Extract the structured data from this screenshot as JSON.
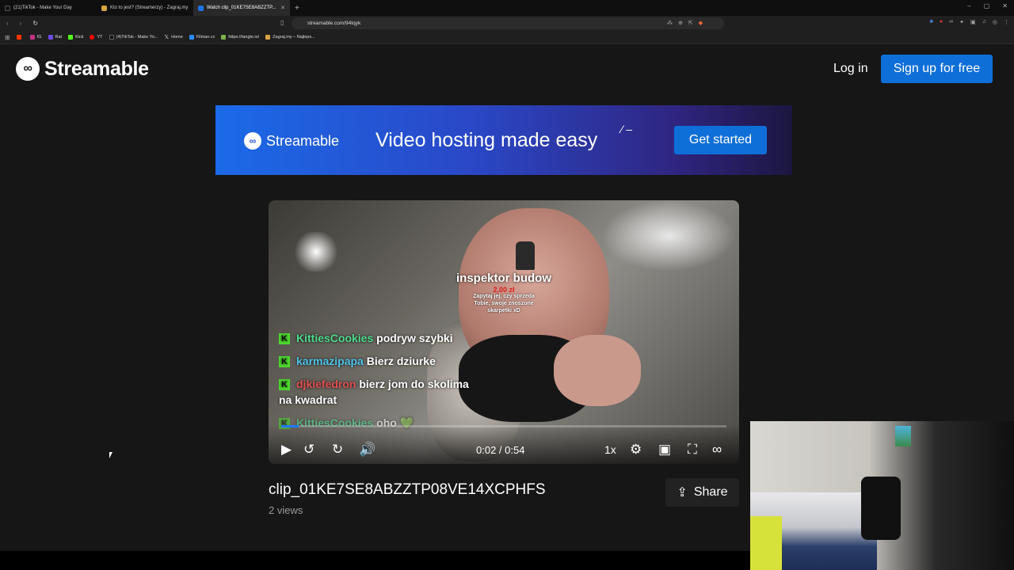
{
  "browser": {
    "tabs": [
      {
        "label": "(21)TikTok - Make Your Day",
        "color": "#111111"
      },
      {
        "label": "Kto to jest? (Streamerzy) - Zagraj.my",
        "color": "#d9a441"
      },
      {
        "label": "Watch clip_01KE7SE8ABZZTP...",
        "color": "#1a73e8",
        "active": true
      }
    ],
    "new_tab": "+",
    "window_controls": [
      "–",
      "▢",
      "✕"
    ],
    "url": "streamable.com/94tqyk",
    "bookmarks": [
      {
        "label": "",
        "color": "#ff3300"
      },
      {
        "label": "IG",
        "color": "#c13584"
      },
      {
        "label": "Rat",
        "color": "#6b4ce6"
      },
      {
        "label": "Kick",
        "color": "#53fc18"
      },
      {
        "label": "YT",
        "color": "#ff0000"
      },
      {
        "label": "(4)TikTok - Make Yo...",
        "color": "#111111"
      },
      {
        "label": "Home",
        "color": "#ffffff"
      },
      {
        "label": "Filman.cc",
        "color": "#2b8cff"
      },
      {
        "label": "https://tangle.io/",
        "color": "#7bb34a"
      },
      {
        "label": "Zagraj.my – Najleps...",
        "color": "#d9a441"
      }
    ]
  },
  "header": {
    "logo_text": "Streamable",
    "login": "Log in",
    "signup": "Sign up for free"
  },
  "banner": {
    "logo_text": "Streamable",
    "headline": "Video hosting made easy",
    "cta": "Get started"
  },
  "video": {
    "overlay_title": "inspektor budow",
    "overlay_price": "2,00 zł",
    "overlay_sub": "Zapytaj jej, czy sprzeda\nTobie, swoje znoszone\nskarpetki xD",
    "chat": [
      {
        "user": "KittiesCookies",
        "user_color": "#4ddb8e",
        "text": "podryw szybki"
      },
      {
        "user": "karmazipapa",
        "user_color": "#4ec3e8",
        "text": "Bierz dziurke"
      },
      {
        "user": "djkiefedron",
        "user_color": "#e05050",
        "text": "bierz jom do skolima na kwadrat"
      },
      {
        "user": "KittiesCookies",
        "user_color": "#4ddb8e",
        "text": "oho 💚"
      }
    ],
    "time": "0:02 / 0:54",
    "speed": "1x",
    "progress_fraction": 0.04
  },
  "clip": {
    "title": "clip_01KE7SE8ABZZTP08VE14XCPHFS",
    "views": "2 views",
    "share": "Share"
  }
}
